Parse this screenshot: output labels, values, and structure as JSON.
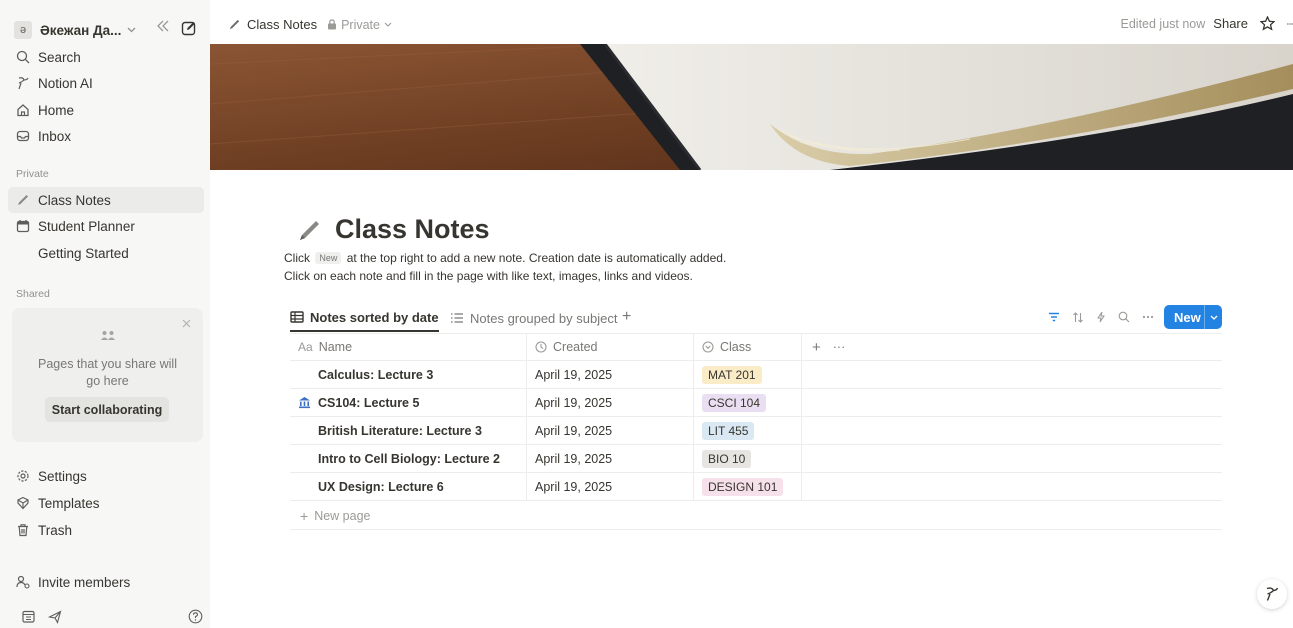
{
  "sidebar": {
    "workspace": {
      "avatar_letter": "ә",
      "name": "Әкежан Да...",
      "chevron": "⌄"
    },
    "nav": [
      {
        "label": "Search",
        "icon": "search-icon"
      },
      {
        "label": "Notion AI",
        "icon": "notion-ai-icon"
      },
      {
        "label": "Home",
        "icon": "home-icon"
      },
      {
        "label": "Inbox",
        "icon": "inbox-icon"
      }
    ],
    "private_label": "Private",
    "private_pages": [
      {
        "label": "Class Notes",
        "icon": "pencil-icon",
        "active": true
      },
      {
        "label": "Student Planner",
        "icon": "calendar-icon",
        "active": false
      },
      {
        "label": "Getting Started",
        "icon": "",
        "active": false
      }
    ],
    "shared_label": "Shared",
    "share_box": {
      "text": "Pages that you share will go here",
      "button": "Start collaborating"
    },
    "bottom": [
      {
        "label": "Settings",
        "icon": "gear-icon"
      },
      {
        "label": "Templates",
        "icon": "templates-icon"
      },
      {
        "label": "Trash",
        "icon": "trash-icon"
      }
    ],
    "invite": "Invite members"
  },
  "topbar": {
    "page": "Class Notes",
    "privacy": "Private",
    "edited": "Edited just now",
    "share": "Share"
  },
  "page": {
    "title": "Class Notes",
    "desc_line1_a": "Click",
    "desc_chip": "New",
    "desc_line1_b": "at the top right to add a new note. Creation date is automatically added.",
    "desc_line2": "Click on each note and fill in the page with like text, images, links and videos."
  },
  "views": {
    "tabs": [
      {
        "label": "Notes sorted by date",
        "active": true
      },
      {
        "label": "Notes grouped by subject",
        "active": false
      }
    ],
    "add": "+",
    "new_button": "New"
  },
  "table": {
    "headers": {
      "name_prefix": "Aa",
      "name": "Name",
      "created": "Created",
      "class": "Class",
      "more": "···",
      "add": "+"
    },
    "rows": [
      {
        "name": "Calculus: Lecture 3",
        "icon": "",
        "created": "April 19, 2025",
        "class": "MAT 201",
        "tag_color": "#fbecc8"
      },
      {
        "name": "CS104: Lecture 5",
        "icon": "bank-icon",
        "created": "April 19, 2025",
        "class": "CSCI 104",
        "tag_color": "#eadff2"
      },
      {
        "name": "British Literature: Lecture 3",
        "icon": "",
        "created": "April 19, 2025",
        "class": "LIT 455",
        "tag_color": "#d9e8f2"
      },
      {
        "name": "Intro to Cell Biology: Lecture 2",
        "icon": "",
        "created": "April 19, 2025",
        "class": "BIO 10",
        "tag_color": "#e6e5e2"
      },
      {
        "name": "UX Design: Lecture 6",
        "icon": "",
        "created": "April 19, 2025",
        "class": "DESIGN 101",
        "tag_color": "#f6e1ea"
      }
    ],
    "new_page": "New page"
  }
}
